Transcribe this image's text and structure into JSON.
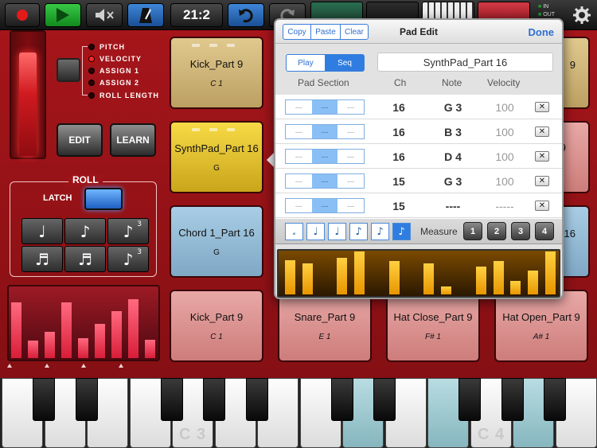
{
  "toolbar": {
    "counter": "21:2",
    "io_in": "IN",
    "io_out": "OUT"
  },
  "params": {
    "items": [
      "PITCH",
      "VELOCITY",
      "ASSIGN 1",
      "ASSIGN 2",
      "ROLL LENGTH"
    ],
    "active_index": 1
  },
  "buttons": {
    "edit": "EDIT",
    "learn": "LEARN"
  },
  "roll": {
    "title": "ROLL",
    "latch": "LATCH",
    "notes": [
      "♩",
      "♪",
      "♪",
      "♬",
      "♬",
      "♪"
    ],
    "triplet": "3"
  },
  "visualizer": {
    "values": [
      0.78,
      0.24,
      0.37,
      0.78,
      0.28,
      0.48,
      0.66,
      0.82,
      0.26
    ]
  },
  "pads": [
    {
      "name": "Kick_Part 9",
      "note": "C 1"
    },
    {
      "name": "SynthPad_Part 16",
      "note": "G"
    },
    {
      "name": "Chord 1_Part 16",
      "note": "G"
    },
    {
      "name": "Kick_Part 9",
      "note": "C 1"
    },
    {
      "name": "Snare_Part 9",
      "note": "E 1"
    },
    {
      "name": "Hat Close_Part 9",
      "note": "F# 1"
    },
    {
      "name": "Hat Open_Part 9",
      "note": "A# 1"
    },
    {
      "name": "9",
      "note": ""
    },
    {
      "name": "16",
      "note": ""
    }
  ],
  "keyboard": {
    "labels": [
      "C 3",
      "C 4"
    ]
  },
  "pad_edit": {
    "title": "Pad Edit",
    "copy": "Copy",
    "paste": "Paste",
    "clear": "Clear",
    "done": "Done",
    "play": "Play",
    "seq": "Seq",
    "pad_name": "SynthPad_Part 16",
    "columns": {
      "section": "Pad Section",
      "ch": "Ch",
      "note": "Note",
      "velocity": "Velocity"
    },
    "section_dash": "---",
    "delete_glyph": "✕",
    "rows": [
      {
        "ch": "16",
        "note": "G 3",
        "velocity": "100"
      },
      {
        "ch": "16",
        "note": "B 3",
        "velocity": "100"
      },
      {
        "ch": "16",
        "note": "D 4",
        "velocity": "100"
      },
      {
        "ch": "15",
        "note": "G 3",
        "velocity": "100"
      },
      {
        "ch": "15",
        "note": "----",
        "velocity": "-----"
      }
    ],
    "note_values": [
      "𝅗",
      "♩",
      "♩",
      "♪",
      "♪",
      "♪"
    ],
    "note_values_selected": 5,
    "measure_label": "Measure",
    "measures": [
      "1",
      "2",
      "3",
      "4"
    ],
    "steps": [
      0.78,
      0.7,
      0,
      0.84,
      0.98,
      0,
      0.76,
      0,
      0.7,
      0.18,
      0,
      0.63,
      0.77,
      0.3,
      0.55,
      0.98
    ]
  },
  "colors": {
    "accent": "#2f7de0",
    "record": "#e21a1a",
    "background": "#9d1318"
  }
}
